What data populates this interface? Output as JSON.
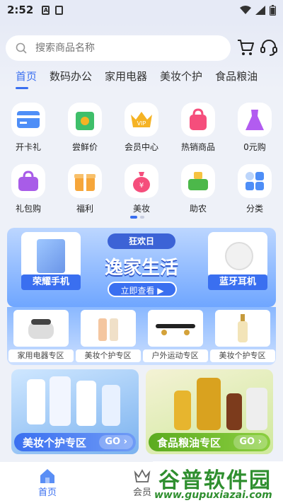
{
  "status": {
    "time": "2:52"
  },
  "search": {
    "placeholder": "搜索商品名称"
  },
  "tabs": [
    "首页",
    "数码办公",
    "家用电器",
    "美妆个护",
    "食品粮油"
  ],
  "categories": [
    {
      "label": "开卡礼",
      "icon": "card-icon",
      "color": "#4e8ef7"
    },
    {
      "label": "尝鲜价",
      "icon": "fresh-bag-icon",
      "color": "#3fbf6a"
    },
    {
      "label": "会员中心",
      "icon": "vip-crown-icon",
      "color": "#f5b324"
    },
    {
      "label": "热销商品",
      "icon": "hot-bag-icon",
      "color": "#f54e7c"
    },
    {
      "label": "0元购",
      "icon": "dress-icon",
      "color": "#b25cf0"
    },
    {
      "label": "礼包购",
      "icon": "gift-bag-icon",
      "color": "#a85ce8"
    },
    {
      "label": "福利",
      "icon": "gift-box-icon",
      "color": "#f6a63a"
    },
    {
      "label": "美妆",
      "icon": "money-bag-icon",
      "color": "#f54e7c"
    },
    {
      "label": "助农",
      "icon": "basket-icon",
      "color": "#4cb84a"
    },
    {
      "label": "分类",
      "icon": "grid-icon",
      "color": "#4e8ef7"
    }
  ],
  "banner": {
    "tag": "狂欢日",
    "title": "逸家生活",
    "button": "立即查看",
    "left_label": "荣耀手机",
    "right_label": "蓝牙耳机"
  },
  "zones": [
    "家用电器专区",
    "美妆个护专区",
    "户外运动专区",
    "美妆个护专区"
  ],
  "cards": [
    {
      "label": "美妆个护专区",
      "go": "GO"
    },
    {
      "label": "食品粮油专区",
      "go": "GO"
    }
  ],
  "bottom_nav": [
    "首页",
    "会员"
  ],
  "watermark": {
    "line1": "谷普软件园",
    "line2": "www.gupuxiazai.com"
  }
}
